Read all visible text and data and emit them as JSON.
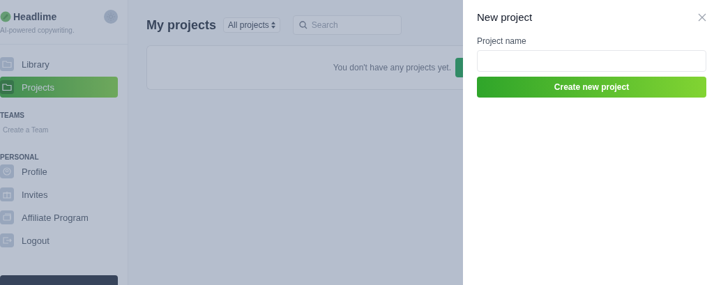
{
  "sidebar": {
    "brand": "Headlime",
    "tagline": "AI-powered copywriting.",
    "nav": [
      {
        "label": "Library",
        "selected": false
      },
      {
        "label": "Projects",
        "selected": true
      }
    ],
    "sections": [
      {
        "heading": "TEAMS",
        "links": [
          "Create a Team"
        ]
      },
      {
        "heading": "PERSONAL",
        "items": [
          {
            "label": "Profile",
            "selected": false
          },
          {
            "label": "Invites",
            "selected": false
          },
          {
            "label": "Affiliate Program",
            "selected": false
          },
          {
            "label": "Logout",
            "selected": false
          }
        ]
      }
    ]
  },
  "main": {
    "title": "My projects",
    "filter": "All projects",
    "search": {
      "placeholder": "Search"
    },
    "empty_message": "You don't have any projects yet."
  },
  "panel": {
    "title": "New project",
    "field_label": "Project name",
    "button": "Create new project"
  }
}
